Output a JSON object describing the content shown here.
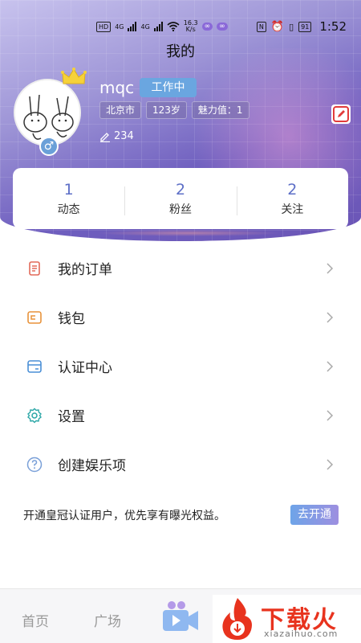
{
  "status_bar": {
    "hd_label": "HD",
    "net1": "4G",
    "net2": "4G",
    "speed_value": "16.3",
    "speed_unit": "K/s",
    "nfc": "N",
    "battery": "91",
    "time": "1:52"
  },
  "page_title": "我的",
  "profile": {
    "username": "mqc",
    "work_badge": "工作中",
    "tags": [
      "北京市",
      "123岁",
      "魅力值：1"
    ],
    "edit_count": "234"
  },
  "stats": [
    {
      "value": "1",
      "label": "动态"
    },
    {
      "value": "2",
      "label": "粉丝"
    },
    {
      "value": "2",
      "label": "关注"
    }
  ],
  "menu": [
    {
      "label": "我的订单",
      "icon": "order-icon"
    },
    {
      "label": "钱包",
      "icon": "wallet-icon"
    },
    {
      "label": "认证中心",
      "icon": "certification-icon"
    },
    {
      "label": "设置",
      "icon": "settings-icon"
    },
    {
      "label": "创建娱乐项",
      "icon": "question-icon"
    }
  ],
  "vip": {
    "text": "开通皇冠认证用户，优先享有曝光权益。",
    "button": "去开通"
  },
  "tabbar": {
    "home": "首页",
    "square": "广场"
  },
  "watermark": {
    "brand": "下载火",
    "site": "xiazaihuo.com"
  },
  "colors": {
    "accent": "#5d6fc7",
    "edit_red": "#e23b3b",
    "watermark_red": "#e8331e"
  }
}
